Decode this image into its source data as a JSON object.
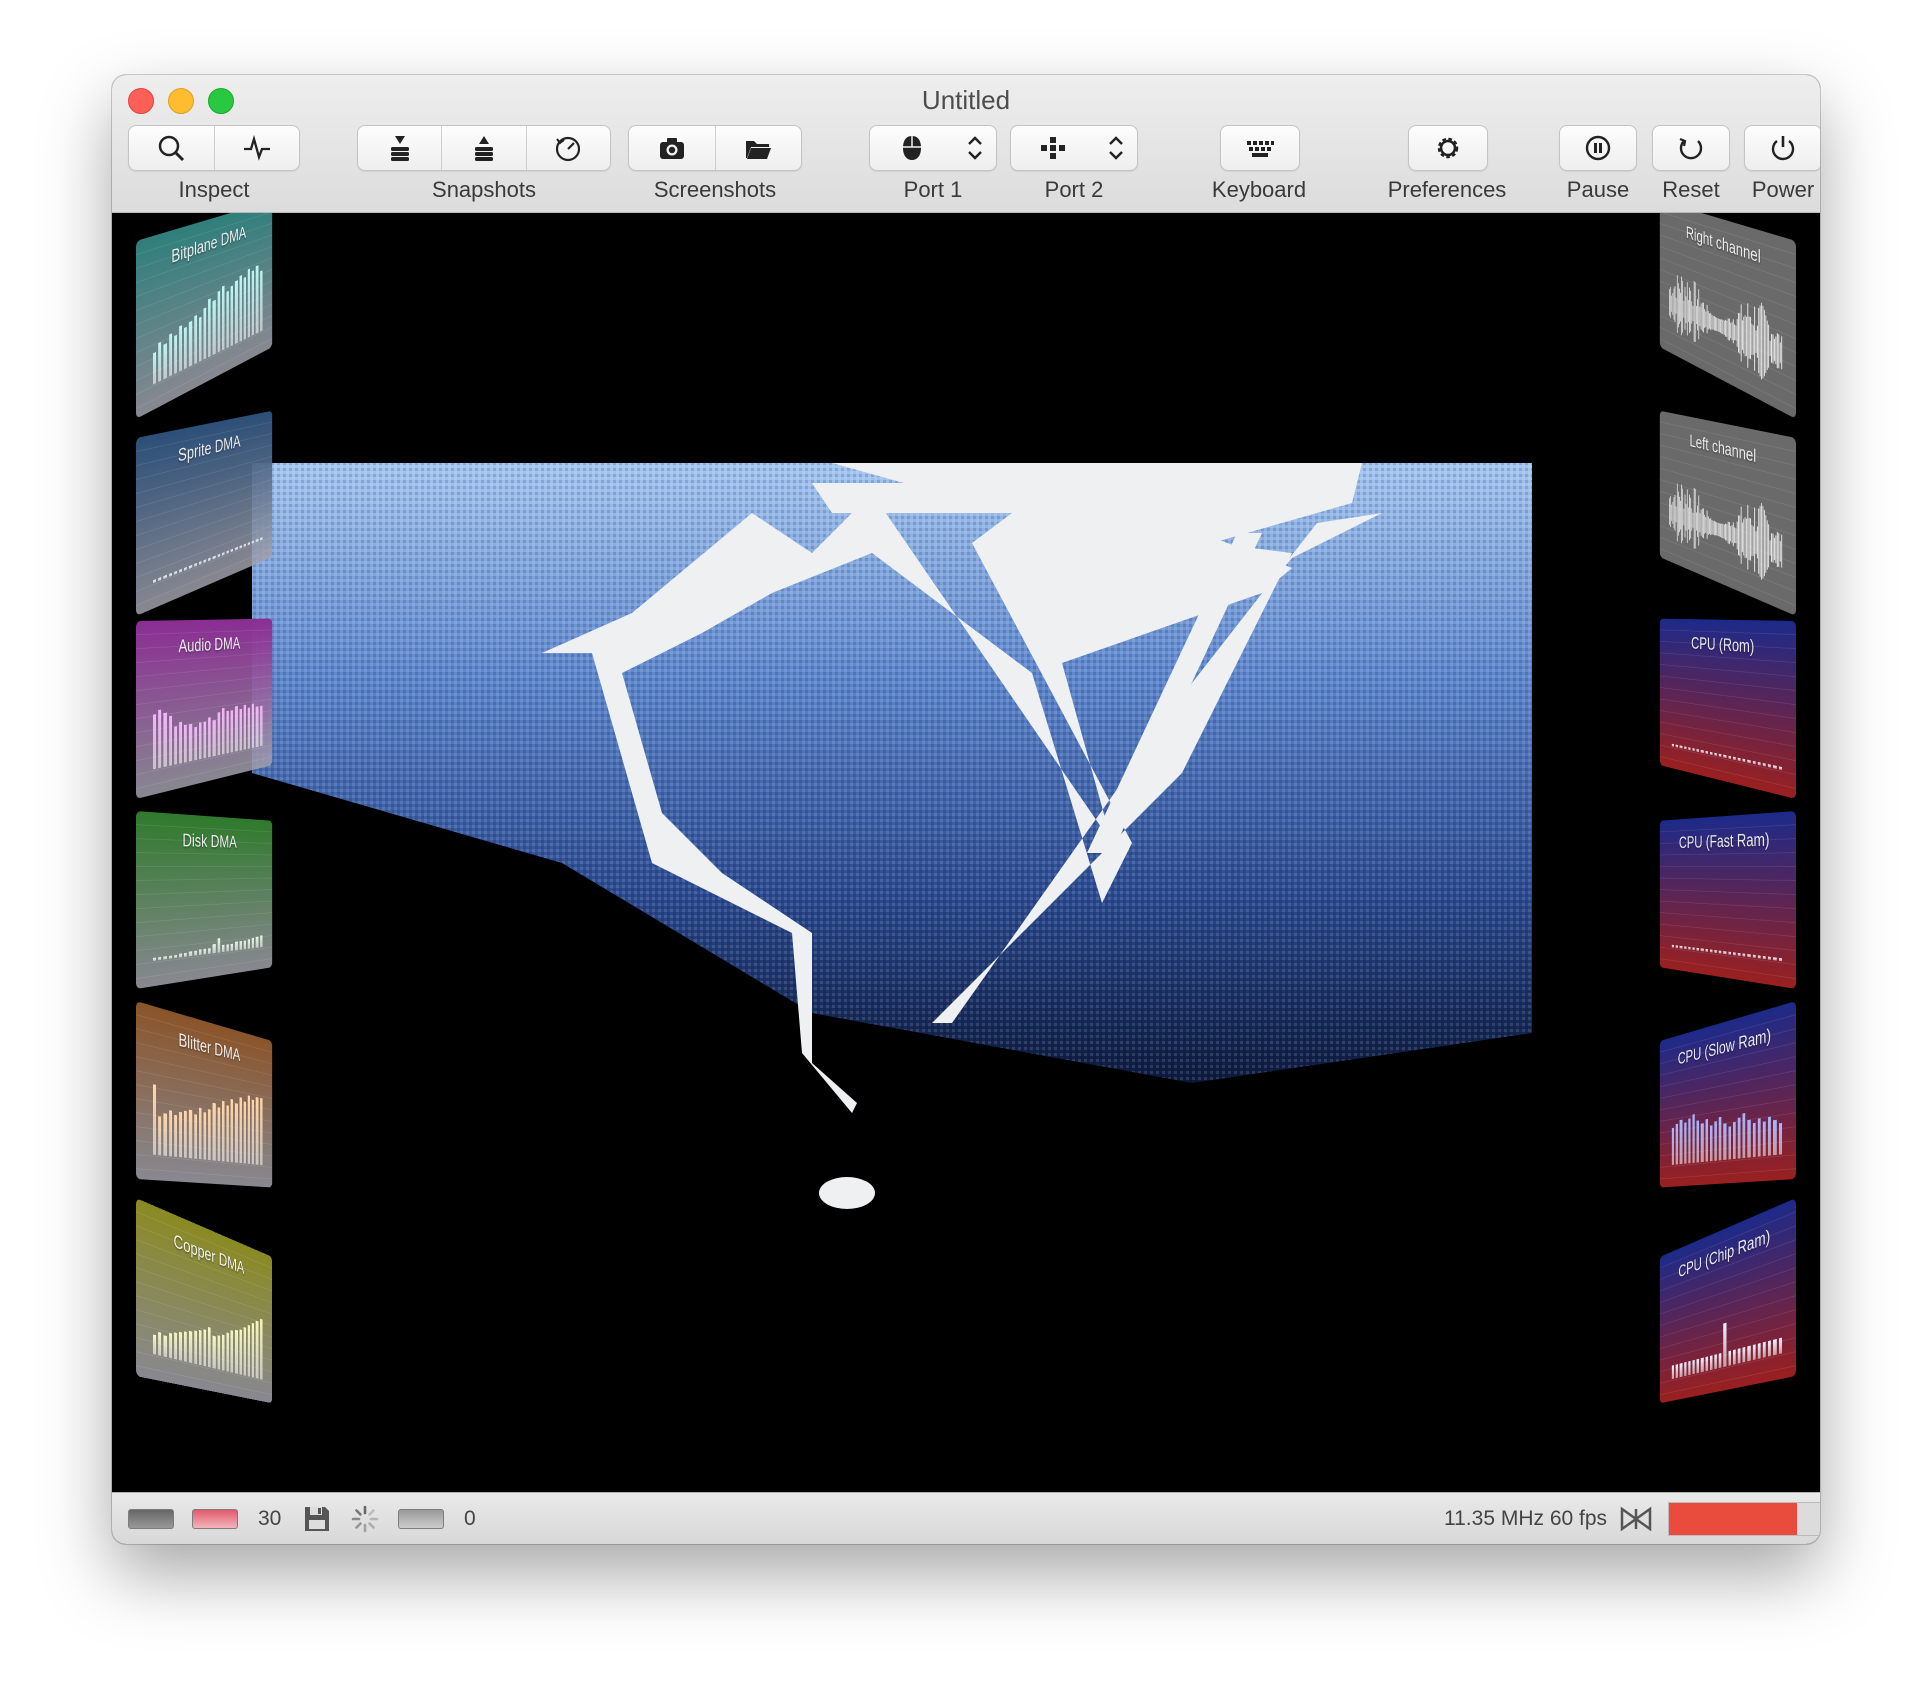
{
  "window": {
    "title": "Untitled"
  },
  "toolbar": {
    "inspect": {
      "label": "Inspect",
      "icons": [
        "magnifier-icon",
        "waveform-icon"
      ]
    },
    "snapshots": {
      "label": "Snapshots",
      "icons": [
        "snapshot-save-icon",
        "snapshot-restore-icon",
        "snapshot-history-icon"
      ]
    },
    "screenshots": {
      "label": "Screenshots",
      "icons": [
        "camera-icon",
        "folder-icon"
      ]
    },
    "port1": {
      "label": "Port 1",
      "icons": [
        "mouse-icon",
        "stepper-icon"
      ]
    },
    "port2": {
      "label": "Port 2",
      "icons": [
        "joystick-icon",
        "stepper-icon"
      ]
    },
    "keyboard": {
      "label": "Keyboard",
      "icons": [
        "keyboard-icon"
      ]
    },
    "preferences": {
      "label": "Preferences",
      "icons": [
        "gear-icon"
      ]
    },
    "pause": {
      "label": "Pause",
      "icons": [
        "pause-icon"
      ]
    },
    "reset": {
      "label": "Reset",
      "icons": [
        "reset-icon"
      ]
    },
    "power": {
      "label": "Power",
      "icons": [
        "power-icon"
      ]
    }
  },
  "left_panels": [
    {
      "title": "Bitplane DMA",
      "color": "#2f7f7c",
      "bar_color": "#bff5f2",
      "values": [
        0.4,
        0.5,
        0.45,
        0.55,
        0.5,
        0.6,
        0.55,
        0.6,
        0.65,
        0.6,
        0.7,
        0.8,
        0.75,
        0.85,
        0.9,
        0.8,
        0.85,
        0.9,
        0.95,
        0.9,
        1.0,
        0.95,
        1.0,
        0.9
      ]
    },
    {
      "title": "Sprite DMA",
      "color": "#2c4f78",
      "bar_color": "#e8eef8",
      "values": [
        0.04,
        0.04,
        0.04,
        0.04,
        0.04,
        0.04,
        0.04,
        0.04,
        0.04,
        0.04,
        0.04,
        0.04,
        0.04,
        0.04,
        0.04,
        0.04,
        0.04,
        0.04,
        0.04,
        0.04,
        0.04,
        0.04,
        0.04,
        0.04
      ]
    },
    {
      "title": "Audio DMA",
      "color": "#8a2d93",
      "bar_color": "#f2b6f6",
      "values": [
        0.7,
        0.75,
        0.7,
        0.65,
        0.5,
        0.55,
        0.5,
        0.5,
        0.45,
        0.5,
        0.5,
        0.55,
        0.5,
        0.6,
        0.65,
        0.6,
        0.6,
        0.65,
        0.6,
        0.65,
        0.6,
        0.65,
        0.6,
        0.6
      ]
    },
    {
      "title": "Disk DMA",
      "color": "#2f7a2c",
      "bar_color": "#e8f5e6",
      "values": [
        0.03,
        0.03,
        0.03,
        0.04,
        0.04,
        0.05,
        0.05,
        0.06,
        0.06,
        0.07,
        0.08,
        0.08,
        0.12,
        0.2,
        0.1,
        0.1,
        0.1,
        0.12,
        0.12,
        0.13,
        0.14,
        0.15,
        0.16,
        0.17
      ]
    },
    {
      "title": "Blitter DMA",
      "color": "#8a5429",
      "bar_color": "#ffd7aa",
      "values": [
        0.9,
        0.5,
        0.55,
        0.6,
        0.55,
        0.6,
        0.62,
        0.65,
        0.6,
        0.7,
        0.65,
        0.7,
        0.8,
        0.75,
        0.85,
        0.8,
        0.9,
        0.85,
        0.95,
        0.9,
        1.0,
        0.95,
        1.0,
        1.0
      ]
    },
    {
      "title": "Copper DMA",
      "color": "#8a8a22",
      "bar_color": "#f6f6c6",
      "values": [
        0.25,
        0.3,
        0.28,
        0.33,
        0.35,
        0.38,
        0.4,
        0.42,
        0.45,
        0.48,
        0.5,
        0.55,
        0.45,
        0.48,
        0.5,
        0.55,
        0.6,
        0.62,
        0.65,
        0.7,
        0.75,
        0.8,
        0.85,
        0.9
      ]
    }
  ],
  "right_panels": [
    {
      "title": "Right channel",
      "type": "wave",
      "color": "#6a6a6a",
      "top_color": "#6a6a6a"
    },
    {
      "title": "Left channel",
      "type": "wave",
      "color": "#6a6a6a",
      "top_color": "#6a6a6a"
    },
    {
      "title": "CPU (Rom)",
      "type": "bars",
      "color": "#9a2020",
      "top_color": "#1d2a8a",
      "bar_color": "#f0f0ff",
      "values": [
        0.03,
        0.03,
        0.03,
        0.03,
        0.03,
        0.03,
        0.03,
        0.03,
        0.03,
        0.03,
        0.03,
        0.03,
        0.03,
        0.03,
        0.03,
        0.03,
        0.03,
        0.03,
        0.03,
        0.03,
        0.03,
        0.03,
        0.03,
        0.03
      ]
    },
    {
      "title": "CPU (Fast Ram)",
      "type": "bars",
      "color": "#9a2020",
      "top_color": "#1d2a8a",
      "bar_color": "#f0f0ff",
      "values": [
        0.03,
        0.03,
        0.03,
        0.03,
        0.03,
        0.03,
        0.03,
        0.03,
        0.03,
        0.03,
        0.03,
        0.03,
        0.03,
        0.03,
        0.03,
        0.03,
        0.03,
        0.03,
        0.03,
        0.03,
        0.03,
        0.03,
        0.03,
        0.03
      ]
    },
    {
      "title": "CPU (Slow Ram)",
      "type": "bars",
      "color": "#9a2020",
      "top_color": "#1d2a8a",
      "bar_color": "#a9b4ff",
      "values": [
        0.55,
        0.6,
        0.65,
        0.6,
        0.65,
        0.7,
        0.6,
        0.55,
        0.6,
        0.5,
        0.55,
        0.6,
        0.5,
        0.45,
        0.5,
        0.55,
        0.6,
        0.5,
        0.45,
        0.5,
        0.45,
        0.5,
        0.45,
        0.4
      ]
    },
    {
      "title": "CPU (Chip Ram)",
      "type": "bars",
      "color": "#9a2020",
      "top_color": "#1d2a8a",
      "bar_color": "#f0f0ff",
      "values": [
        0.2,
        0.2,
        0.2,
        0.2,
        0.2,
        0.2,
        0.2,
        0.2,
        0.2,
        0.2,
        0.2,
        0.2,
        0.6,
        0.2,
        0.2,
        0.2,
        0.2,
        0.2,
        0.2,
        0.2,
        0.2,
        0.2,
        0.2,
        0.2
      ]
    }
  ],
  "statusbar": {
    "drive_count": "30",
    "queue_count": "0",
    "speed": "11.35 MHz 60 fps",
    "icons": [
      "drive-df0-icon",
      "drive-df1-icon",
      "floppy-disk-icon",
      "activity-spinner-icon",
      "drive-df2-icon",
      "warp-icon"
    ],
    "speed_meter": 0.8,
    "colors": {
      "led_off": "#8a8a8a",
      "led_red": "#e88b95",
      "speed": "#e94b3c"
    }
  }
}
